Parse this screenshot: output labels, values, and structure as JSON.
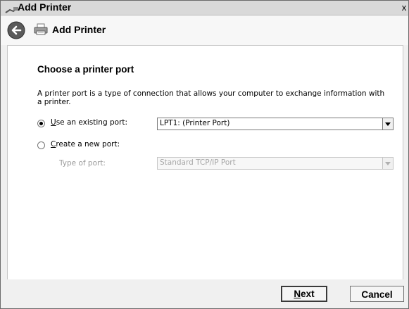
{
  "window": {
    "title": "Add Printer",
    "close_glyph": "x",
    "icons": {
      "title": "printer-wizard-icon"
    }
  },
  "header": {
    "title": "Add Printer",
    "icons": {
      "back": "back-arrow-icon",
      "printer": "printer-icon"
    }
  },
  "page": {
    "heading": "Choose a printer port",
    "description": "A printer port is a type of connection that allows your computer to exchange information with a printer.",
    "existing_port": {
      "label_underline": "U",
      "label_rest": "se an existing port:",
      "selected": true,
      "value": "LPT1: (Printer Port)"
    },
    "new_port": {
      "label_underline": "C",
      "label_rest": "reate a new port:",
      "selected": false,
      "type_label": "Type of port:",
      "type_value": "Standard TCP/IP Port"
    }
  },
  "footer": {
    "next_underline": "N",
    "next_rest": "ext",
    "cancel_label": "Cancel"
  },
  "colors": {
    "window_bg": "#f0f0f0",
    "content_bg": "#ffffff",
    "disabled_text": "#9a9a9a"
  }
}
